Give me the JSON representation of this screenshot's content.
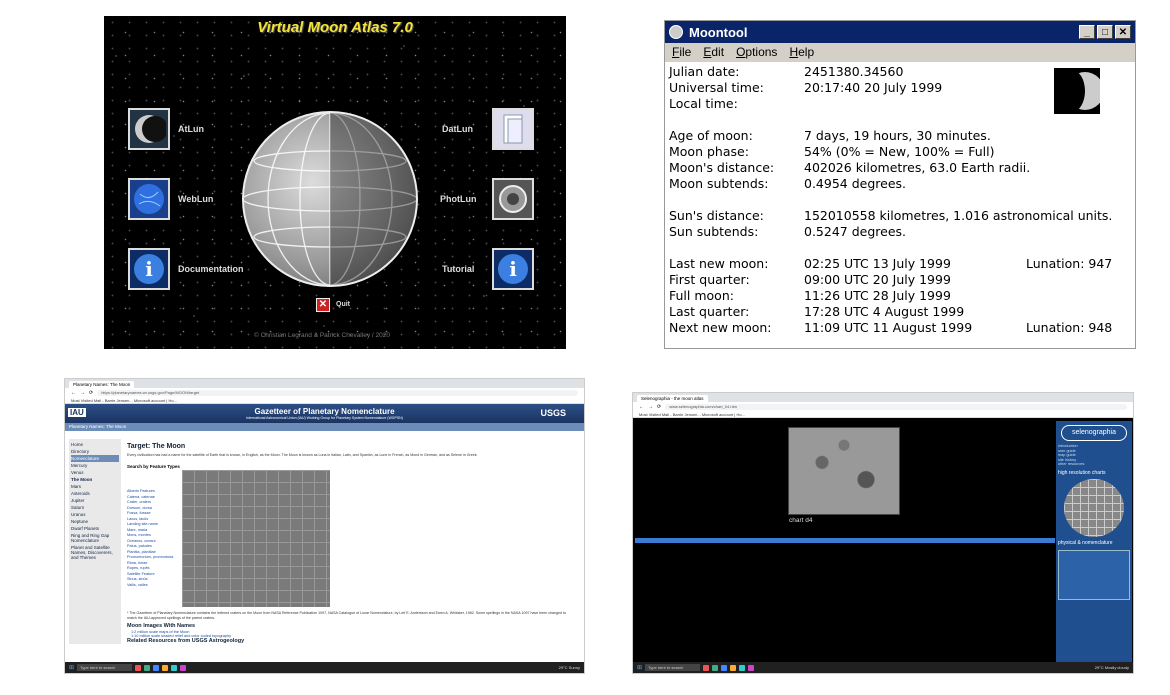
{
  "vma": {
    "title": "Virtual Moon Atlas 7.0",
    "buttons": [
      {
        "label": "AtLun"
      },
      {
        "label": "WebLun"
      },
      {
        "label": "Documentation"
      },
      {
        "label": "DatLun"
      },
      {
        "label": "PhotLun"
      },
      {
        "label": "Tutorial"
      }
    ],
    "quit": "Quit",
    "copyright": "© Christian Legrand & Patrick Chevalley / 2020"
  },
  "moontool": {
    "title": "Moontool",
    "menu": [
      "File",
      "Edit",
      "Options",
      "Help"
    ],
    "rows": [
      {
        "label": "Julian date:",
        "value": "2451380.34560"
      },
      {
        "label": "Universal time:",
        "value": "20:17:40 20 July 1999"
      },
      {
        "label": "Local time:",
        "value": ""
      },
      {
        "label": "Age of moon:",
        "value": "7 days, 19 hours, 30 minutes."
      },
      {
        "label": "Moon phase:",
        "value": "54%   (0% = New, 100% = Full)"
      },
      {
        "label": "Moon's distance:",
        "value": "402026 kilometres, 63.0 Earth radii."
      },
      {
        "label": "Moon subtends:",
        "value": "0.4954 degrees."
      },
      {
        "label": "Sun's distance:",
        "value": "152010558 kilometres, 1.016 astronomical units."
      },
      {
        "label": "Sun subtends:",
        "value": "0.5247 degrees."
      },
      {
        "label": "Last new moon:",
        "value": "02:25 UTC 13 July 1999",
        "lunation": "Lunation: 947"
      },
      {
        "label": "First quarter:",
        "value": "09:00 UTC 20 July 1999"
      },
      {
        "label": "Full moon:",
        "value": "11:26 UTC 28 July 1999"
      },
      {
        "label": "Last quarter:",
        "value": "17:28 UTC  4 August 1999"
      },
      {
        "label": "Next new moon:",
        "value": "11:09 UTC 11 August 1999",
        "lunation": "Lunation: 948"
      }
    ]
  },
  "gazetteer": {
    "tab": "Planetary Names: The Moon",
    "url": "https://planetarynames.wr.usgs.gov/Page/MOON/target",
    "bookmarks": "Most Visited   Mail - Barrie Jensen...   Microsoft account | Ho...",
    "title": "Gazetteer of Planetary Nomenclature",
    "subtitle": "International Astronomical Union (IAU) Working Group for Planetary System Nomenclature (WGPSN)",
    "iau": "IAU",
    "usgs": "USGS",
    "crumbs": "Planetary Names: The Moon",
    "side": [
      "Home",
      "Directory",
      "Nomenclature",
      "Mercury",
      "Venus",
      "The Moon",
      "Mars",
      "Asteroids",
      "Jupiter",
      "Saturn",
      "Uranus",
      "Neptune",
      "Dwarf Planets",
      "Ring and Ring Gap Nomenclature",
      "Planet and Satellite Names, Discoverers, and Themes"
    ],
    "heading": "Target: The Moon",
    "intro": "Every civilization has had a name for the satellite of Earth that is known, in English, as the Moon. The Moon is known as Luna in Italian, Latin, and Spanish, as Lune in French, as Mond in German, and as Selene in Greek.",
    "search_heading": "Search by Feature Types",
    "links": [
      "Albedo Features",
      "Catena, catenae",
      "Crater, craters",
      "Dorsum, dorsa",
      "Fossa, fossae",
      "Lacus, lacūs",
      "Landing site name",
      "Mare, maria",
      "Mons, montes",
      "Oceanus, oceani",
      "Palus, paludes",
      "Planitia, planitiae",
      "Promontorium, promontoria",
      "Rima, rimae",
      "Rupes, rupēs",
      "Satellite Feature",
      "Sinus, sinūs",
      "Vallis, valles"
    ],
    "footnote": "* The Gazetteer of Planetary Nomenclature contains the lettered craters on the Moon from NASA Reference Publication 1097, NASA Catalogue of Lunar Nomenclature, by Leif E. Andersson and Ewen A. Whitaker, 1982. Some spellings in the NASA 1097 have been changed to match the IAU-approved spellings of the parent craters.",
    "images_heading": "Moon Images With Names",
    "image_links": [
      "1:2 million scale maps of the Moon",
      "1:10 million scale shaded relief and color coded topography"
    ],
    "related_heading": "Related Resources from USGS Astrogeology"
  },
  "selenographia": {
    "tab": "Selenographia - the moon atlas",
    "url": "www.selenographia.com/chart_04.htm",
    "bookmarks": "Most Visited   Mail - Barrie Jensen...   Microsoft account | Ho...",
    "chart_label": "chart d4",
    "logo": "selenographia",
    "links": [
      "introduction",
      "user guide",
      "map guide",
      "site history",
      "other resources"
    ],
    "hi_res": "high resolution charts",
    "physical": "physical & nomenclature"
  },
  "taskbar": {
    "search": "Type here to search",
    "weather": "29°C Sunny",
    "weather2": "29°C Mostly cloudy"
  }
}
